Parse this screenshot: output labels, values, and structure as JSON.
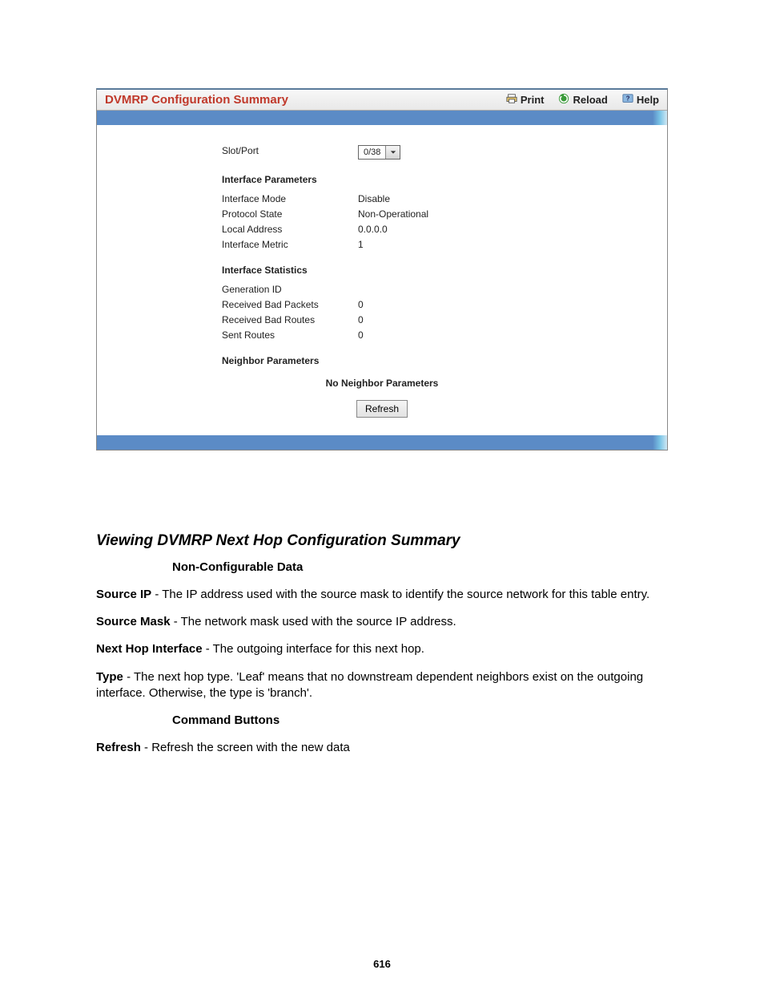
{
  "panel": {
    "title": "DVMRP Configuration Summary",
    "actions": {
      "print": "Print",
      "reload": "Reload",
      "help": "Help"
    }
  },
  "form": {
    "slot_port_label": "Slot/Port",
    "slot_port_value": "0/38",
    "sections": {
      "iface_params": "Interface Parameters",
      "iface_stats": "Interface Statistics",
      "neighbor_params": "Neighbor Parameters"
    },
    "params": {
      "interface_mode_label": "Interface Mode",
      "interface_mode_value": "Disable",
      "protocol_state_label": "Protocol State",
      "protocol_state_value": "Non-Operational",
      "local_address_label": "Local Address",
      "local_address_value": "0.0.0.0",
      "interface_metric_label": "Interface Metric",
      "interface_metric_value": "1"
    },
    "stats": {
      "generation_id_label": "Generation ID",
      "generation_id_value": "",
      "rx_bad_packets_label": "Received Bad Packets",
      "rx_bad_packets_value": "0",
      "rx_bad_routes_label": "Received Bad Routes",
      "rx_bad_routes_value": "0",
      "sent_routes_label": "Sent Routes",
      "sent_routes_value": "0"
    },
    "no_neighbor": "No Neighbor Parameters",
    "refresh": "Refresh"
  },
  "doc": {
    "title": "Viewing DVMRP Next Hop Configuration Summary",
    "nonconfig_heading": "Non-Configurable Data",
    "source_ip_term": "Source IP",
    "source_ip_desc": " - The IP address used with the source mask to identify the source network for this table entry.",
    "source_mask_term": "Source Mask",
    "source_mask_desc": " - The network mask used with the source IP address.",
    "next_hop_if_term": "Next Hop Interface",
    "next_hop_if_desc": " - The outgoing interface for this next hop.",
    "type_term": "Type",
    "type_desc": " - The next hop type. 'Leaf' means that no downstream dependent neighbors exist on the outgoing interface. Otherwise, the type is 'branch'.",
    "cmd_buttons_heading": "Command Buttons",
    "refresh_term": "Refresh",
    "refresh_desc": " - Refresh the screen with the new data"
  },
  "page_number": "616"
}
